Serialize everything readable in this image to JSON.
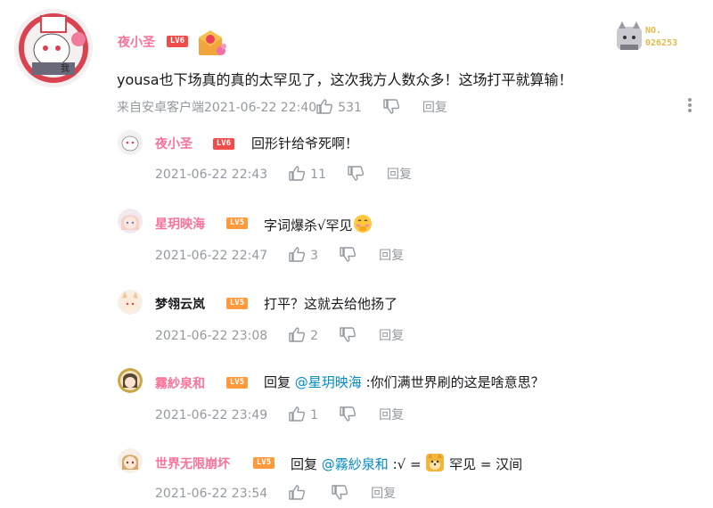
{
  "colors": {
    "name_pink": "#fb7299",
    "meta_gray": "#9499a0",
    "link_blue": "#008ac5",
    "lv6_red": "#f04c49",
    "lv5_orange": "#ff9a3c"
  },
  "main_comment": {
    "username": "夜小圣",
    "level": "LV6",
    "fan_badge": {
      "title": "NO.",
      "number": "026253"
    },
    "text": "yousa也下场真的真的太罕见了，这次我方人数众多！这场打平就算输！",
    "source": "来自安卓客户端",
    "time": "2021-06-22 22:40",
    "likes": "531",
    "reply_label": "回复"
  },
  "replies": [
    {
      "username": "夜小圣",
      "level": "LV6",
      "text": "回形针给爷死啊！",
      "time": "2021-06-22 22:43",
      "likes": "11",
      "reply_label": "回复"
    },
    {
      "username": "星玥映海",
      "level": "LV5",
      "text": "字词爆杀√罕见",
      "time": "2021-06-22 22:47",
      "likes": "3",
      "reply_label": "回复"
    },
    {
      "username": "梦翎云岚",
      "level": "LV5",
      "text": "打平？这就去给他扬了",
      "time": "2021-06-22 23:08",
      "likes": "2",
      "reply_label": "回复"
    },
    {
      "username": "霧紗泉和",
      "level": "LV5",
      "reply_prefix": "回复",
      "mention": "@星玥映海",
      "text": ":你们满世界刷的这是啥意思？",
      "time": "2021-06-22 23:49",
      "likes": "1",
      "reply_label": "回复"
    },
    {
      "username": "世界无限崩坏",
      "level": "LV5",
      "reply_prefix": "回复",
      "mention": "@霧紗泉和",
      "text_a": ":√ = ",
      "text_b": " 罕见 = 汉间",
      "time": "2021-06-22 23:54",
      "likes": "",
      "reply_label": "回复"
    }
  ]
}
